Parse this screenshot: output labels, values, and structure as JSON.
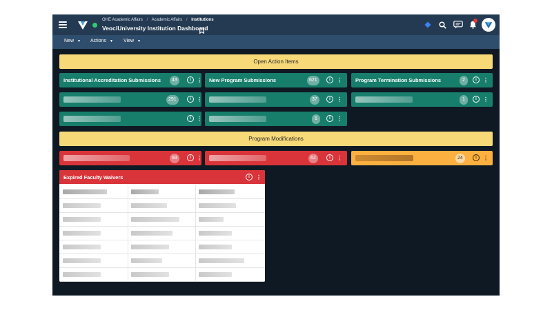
{
  "header": {
    "breadcrumbs": [
      "OHE Academic Affairs",
      "Academic Affairs",
      "Institutions"
    ],
    "breadcrumb_separator": "/",
    "title": "VeociUniversity Institution Dashboard",
    "icons": [
      "menu-icon",
      "veoci-logo-icon",
      "status-dot-icon",
      "bookmark-icon",
      "diamond-icon",
      "search-icon",
      "chat-icon",
      "bell-icon",
      "avatar-icon"
    ],
    "status_color": "#2ecc71"
  },
  "toolbar": {
    "new_label": "New",
    "actions_label": "Actions",
    "view_label": "View"
  },
  "sections": {
    "open_action_items": "Open Action Items",
    "program_modifications": "Program Modifications"
  },
  "tiles": {
    "accreditation": {
      "label": "Institutional Accreditation Submissions",
      "count": "43"
    },
    "new_program": {
      "label": "New Program Submissions",
      "count": "621"
    },
    "program_termination": {
      "label": "Program Termination Submissions",
      "count": "2"
    },
    "row2_a": {
      "count": "291"
    },
    "row2_b": {
      "count": "37"
    },
    "row2_c": {
      "count": "1"
    },
    "row3_b": {
      "count": "5"
    },
    "mod_a": {
      "count": "93"
    },
    "mod_b": {
      "count": "62"
    },
    "mod_c": {
      "count": "24"
    }
  },
  "card": {
    "title": "Expired Faculty Waivers"
  },
  "colors": {
    "background": "#0f1923",
    "header": "#243a52",
    "toolbar": "#2f4d6c",
    "banner": "#f8d978",
    "green": "#177e6c",
    "red": "#d9343a",
    "orange": "#fbb040"
  }
}
